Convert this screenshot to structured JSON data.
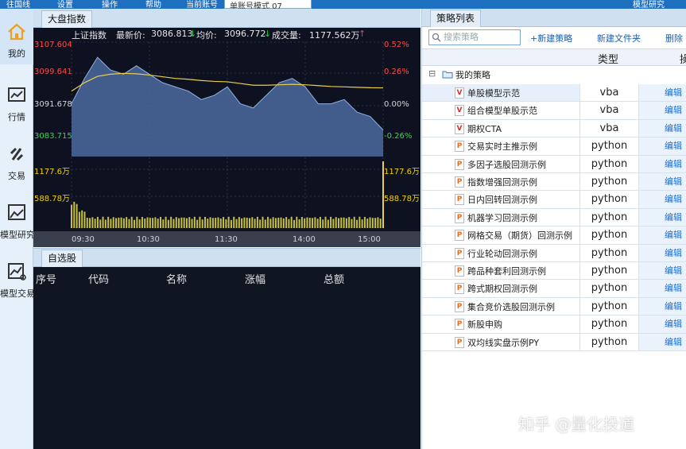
{
  "topbar": {
    "items": [
      "往国线",
      "设置",
      "操作",
      "帮助",
      "当前账号"
    ],
    "account": "单账号模式 07",
    "right": "模型研究"
  },
  "sidebar": {
    "items": [
      {
        "label": "我的",
        "icon": "home-icon"
      },
      {
        "label": "行情",
        "icon": "chart-icon"
      },
      {
        "label": "交易",
        "icon": "exchange-icon"
      },
      {
        "label": "模型研究",
        "icon": "research-icon"
      },
      {
        "label": "模型交易",
        "icon": "model-trade-icon"
      }
    ]
  },
  "market": {
    "tab": "大盘指数",
    "index_name": "上证指数",
    "latest_label": "最新价:",
    "latest": "3086.813",
    "avg_label": "均价:",
    "avg": "3096.772",
    "volume_label": "成交量:",
    "volume": "1177.562万",
    "price_labels": [
      "3107.604",
      "3099.641",
      "3091.678",
      "3083.715"
    ],
    "pct_labels": [
      "0.52%",
      "0.26%",
      "0.00%",
      "-0.26%"
    ],
    "volume_labels": [
      "1177.6万",
      "588.78万"
    ],
    "time_labels": [
      "09:30",
      "10:30",
      "11:30",
      "14:00",
      "15:00"
    ]
  },
  "chart_data": {
    "type": "line",
    "title": "上证指数",
    "x": [
      "09:30",
      "09:40",
      "09:50",
      "10:00",
      "10:10",
      "10:20",
      "10:30",
      "10:40",
      "10:50",
      "11:00",
      "11:10",
      "11:20",
      "11:30",
      "13:10",
      "13:20",
      "13:30",
      "13:40",
      "13:50",
      "14:00",
      "14:10",
      "14:20",
      "14:30",
      "14:40",
      "14:50",
      "15:00"
    ],
    "series": [
      {
        "name": "最新价",
        "values": [
          3093,
          3099,
          3104,
          3101,
          3100,
          3102,
          3100,
          3098,
          3097,
          3096,
          3094,
          3095,
          3097,
          3093,
          3092,
          3095,
          3098,
          3099,
          3097,
          3093,
          3093,
          3094,
          3091,
          3090,
          3086.8
        ]
      },
      {
        "name": "均价",
        "values": [
          3096,
          3098,
          3099.5,
          3100,
          3100.2,
          3100.1,
          3099.8,
          3099.4,
          3099.0,
          3098.8,
          3098.5,
          3098.3,
          3098.2,
          3097.8,
          3097.4,
          3097.4,
          3097.5,
          3097.6,
          3097.5,
          3097.3,
          3097.1,
          3097.0,
          3096.9,
          3096.8,
          3096.77
        ]
      }
    ],
    "ylim": [
      3080.5,
      3107.604
    ],
    "volume_ylim": [
      0,
      1177.6
    ]
  },
  "watchlist": {
    "tab": "自选股",
    "columns": [
      "序号",
      "代码",
      "名称",
      "涨幅",
      "总额"
    ]
  },
  "strategy": {
    "tab": "策略列表",
    "search_placeholder": "搜索策略",
    "new_strategy": "+新建策略",
    "new_folder": "新建文件夹",
    "delete": "删除",
    "type_header": "类型",
    "action_header": "操",
    "folder": "我的策略",
    "edit_label": "编辑",
    "rows": [
      {
        "name": "单股模型示范",
        "type": "vba",
        "icon": "v"
      },
      {
        "name": "组合模型单股示范",
        "type": "vba",
        "icon": "v"
      },
      {
        "name": "期权CTA",
        "type": "vba",
        "icon": "v"
      },
      {
        "name": "交易实时主推示例",
        "type": "python",
        "icon": "p"
      },
      {
        "name": "多因子选股回测示例",
        "type": "python",
        "icon": "p"
      },
      {
        "name": "指数增强回测示例",
        "type": "python",
        "icon": "p"
      },
      {
        "name": "日内回转回测示例",
        "type": "python",
        "icon": "p"
      },
      {
        "name": "机器学习回测示例",
        "type": "python",
        "icon": "p"
      },
      {
        "name": "网格交易（期货）回测示例",
        "type": "python",
        "icon": "p"
      },
      {
        "name": "行业轮动回测示例",
        "type": "python",
        "icon": "p"
      },
      {
        "name": "跨品种套利回测示例",
        "type": "python",
        "icon": "p"
      },
      {
        "name": "跨式期权回测示例",
        "type": "python",
        "icon": "p"
      },
      {
        "name": "集合竞价选股回测示例",
        "type": "python",
        "icon": "p"
      },
      {
        "name": "新股申购",
        "type": "python",
        "icon": "p"
      },
      {
        "name": "双均线实盘示例PY",
        "type": "python",
        "icon": "p"
      }
    ]
  },
  "watermark": "知乎 @量化投道"
}
